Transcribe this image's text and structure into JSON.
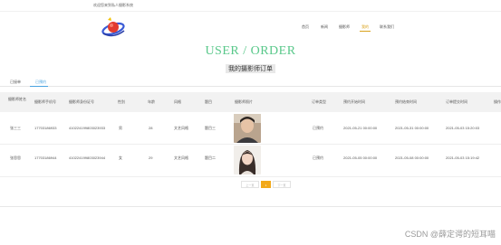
{
  "header": {
    "welcome": "欢迎您来到私人摄影系统"
  },
  "nav": {
    "items": [
      {
        "label": "首页"
      },
      {
        "label": "新闻"
      },
      {
        "label": "摄影师"
      },
      {
        "label": "我的"
      },
      {
        "label": "联系我们"
      }
    ],
    "active_index": 3
  },
  "page": {
    "title_en": "USER / ORDER",
    "title_cn": "我的摄影师订单"
  },
  "tabs": {
    "items": [
      {
        "label": "已接单"
      },
      {
        "label": "已预约"
      }
    ],
    "active_index": 1
  },
  "table": {
    "columns": [
      "摄影师姓名",
      "摄影师手机号",
      "摄影师身份证号",
      "性别",
      "年龄",
      "风格",
      "题目",
      "摄影师照片",
      "订单类型",
      "预约开始时间",
      "预约结束时间",
      "订单提交时间",
      "操作"
    ],
    "rows": [
      {
        "name": "张三三",
        "phone": "17703186933",
        "id_card": "410224199803023933",
        "gender": "男",
        "age": "28",
        "style": "文艺风格",
        "subject": "题目三",
        "order_type": "已预约",
        "start": "2021-05-21 00:00:00",
        "end": "2021-05-31 00:00:00",
        "submitted": "2021-05-03 15:20:03"
      },
      {
        "name": "张思思",
        "phone": "17703186944",
        "id_card": "410224199803023944",
        "gender": "女",
        "age": "29",
        "style": "文艺风格",
        "subject": "题目二",
        "order_type": "已预约",
        "start": "2021-05-05 00:00:00",
        "end": "2021-05-08 00:00:00",
        "submitted": "2021-05-03 15:19:42"
      }
    ]
  },
  "pagination": {
    "prev": "上一页",
    "current": "1",
    "next": "下一页"
  },
  "watermark": "CSDN @薛定谔的短耳喵",
  "colors": {
    "accent": "#59c88a",
    "nav_active": "#d9a21c",
    "tab_active": "#4aa3e0",
    "page_active": "#f2a91a"
  }
}
